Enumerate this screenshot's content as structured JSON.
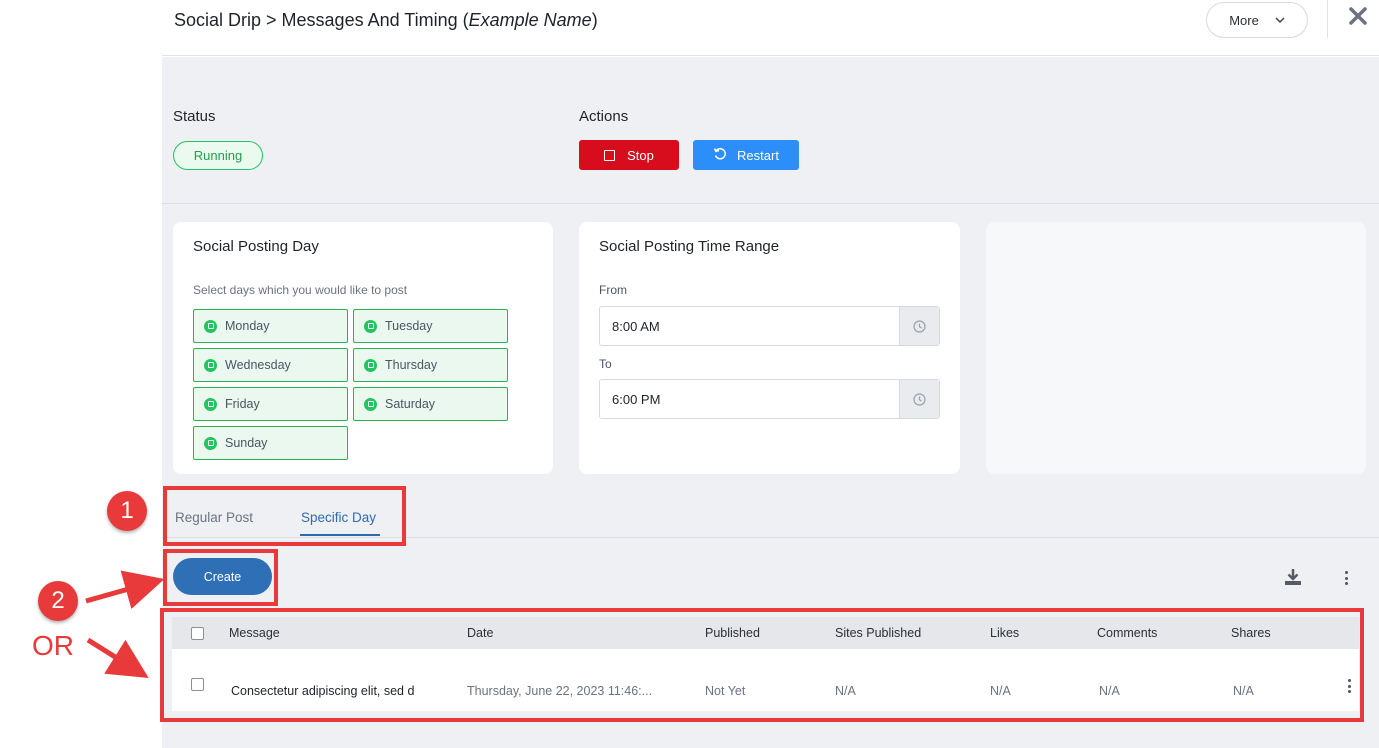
{
  "header": {
    "title_prefix": "Social Drip > Messages And Timing (",
    "title_name": "Example Name",
    "title_suffix": ")",
    "more_label": "More"
  },
  "status": {
    "heading": "Status",
    "value": "Running"
  },
  "actions": {
    "heading": "Actions",
    "stop_label": "Stop",
    "restart_label": "Restart"
  },
  "posting_day": {
    "title": "Social Posting Day",
    "subtitle": "Select days which you would like to post",
    "days": [
      "Monday",
      "Tuesday",
      "Wednesday",
      "Thursday",
      "Friday",
      "Saturday",
      "Sunday"
    ]
  },
  "time_range": {
    "title": "Social Posting Time Range",
    "from_label": "From",
    "from_value": "8:00 AM",
    "to_label": "To",
    "to_value": "6:00 PM"
  },
  "tabs": {
    "regular": "Regular Post",
    "specific": "Specific Day",
    "active": "Specific Day"
  },
  "create_label": "Create",
  "table": {
    "columns": [
      "Message",
      "Date",
      "Published",
      "Sites Published",
      "Likes",
      "Comments",
      "Shares"
    ],
    "rows": [
      {
        "message": "Consectetur adipiscing elit, sed d",
        "date": "Thursday, June 22, 2023 11:46:...",
        "published": "Not Yet",
        "sites_published": "N/A",
        "likes": "N/A",
        "comments": "N/A",
        "shares": "N/A"
      }
    ]
  },
  "annotations": {
    "step1": "1",
    "step2": "2",
    "or": "OR"
  },
  "colors": {
    "stop": "#d70d1d",
    "restart": "#2c8ef8",
    "create": "#2e6fb5",
    "running": "#22c55e",
    "annotation": "#e83a3a"
  }
}
